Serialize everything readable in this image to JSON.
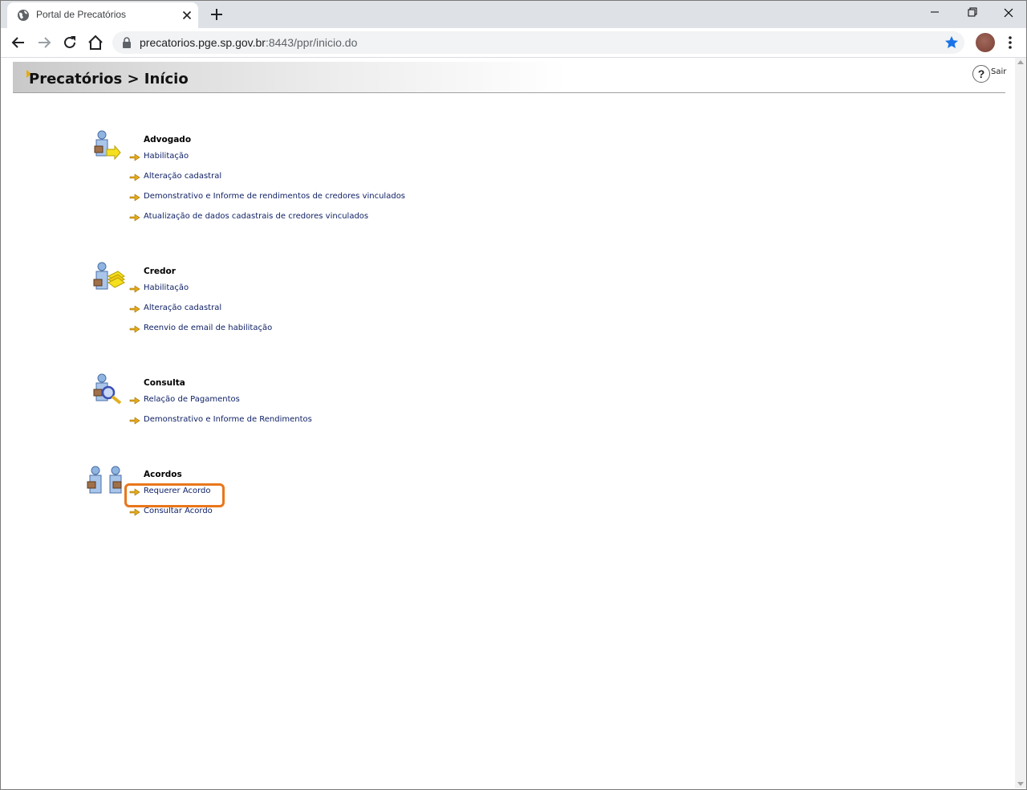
{
  "browser": {
    "tab_title": "Portal de Precatórios",
    "url_host": "precatorios.pge.sp.gov.br",
    "url_path": ":8443/ppr/inicio.do"
  },
  "page": {
    "title": "Precatórios > Início",
    "help_label": "?",
    "logout_label": "Sair"
  },
  "sections": [
    {
      "title": "Advogado",
      "links": [
        "Habilitação",
        "Alteração cadastral",
        "Demonstrativo e Informe de rendimentos de credores vinculados",
        "Atualização de dados cadastrais de credores vinculados"
      ]
    },
    {
      "title": "Credor",
      "links": [
        "Habilitação",
        "Alteração cadastral",
        "Reenvio de email de habilitação"
      ]
    },
    {
      "title": "Consulta",
      "links": [
        "Relação de Pagamentos",
        "Demonstrativo e Informe de Rendimentos"
      ]
    },
    {
      "title": "Acordos",
      "links": [
        "Requerer Acordo",
        "Consultar Acordo"
      ]
    }
  ],
  "colors": {
    "link": "#102266",
    "highlight": "#e9761b",
    "arrow": "#e7a915"
  }
}
